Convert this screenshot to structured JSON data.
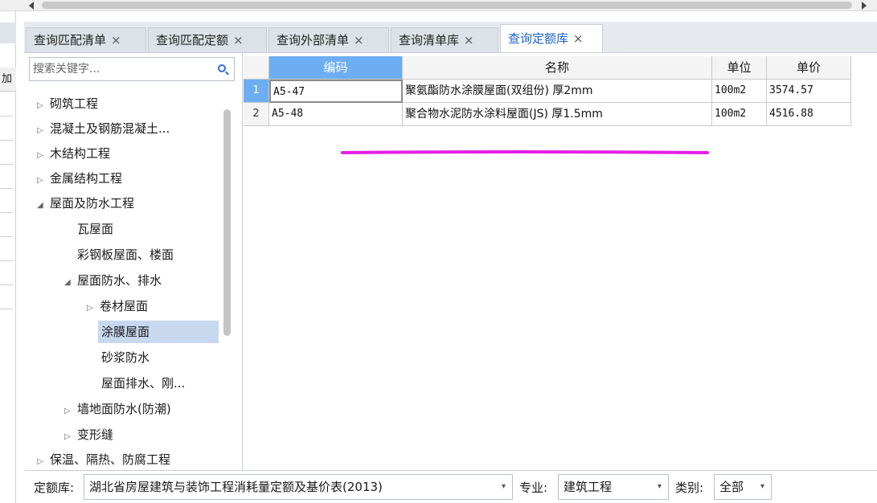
{
  "tabs": [
    {
      "label": "查询匹配清单",
      "active": false
    },
    {
      "label": "查询匹配定额",
      "active": false
    },
    {
      "label": "查询外部清单",
      "active": false
    },
    {
      "label": "查询清单库",
      "active": false
    },
    {
      "label": "查询定额库",
      "active": true
    }
  ],
  "tab_close_glyph": "×",
  "left_strip_header": "加",
  "search": {
    "placeholder": "搜索关键字..."
  },
  "tree": [
    {
      "label": "砌筑工程",
      "expanded": false,
      "level": 0
    },
    {
      "label": "混凝土及钢筋混凝土...",
      "expanded": false,
      "level": 0
    },
    {
      "label": "木结构工程",
      "expanded": false,
      "level": 0
    },
    {
      "label": "金属结构工程",
      "expanded": false,
      "level": 0
    },
    {
      "label": "屋面及防水工程",
      "expanded": true,
      "level": 0
    },
    {
      "label": "瓦屋面",
      "level": 1
    },
    {
      "label": "彩钢板屋面、楼面",
      "level": 1
    },
    {
      "label": "屋面防水、排水",
      "expanded": true,
      "level": 1
    },
    {
      "label": "卷材屋面",
      "expanded": false,
      "level": 2
    },
    {
      "label": "涂膜屋面",
      "level": 2,
      "selected": true
    },
    {
      "label": "砂浆防水",
      "level": 2
    },
    {
      "label": "屋面排水、刚...",
      "level": 2
    },
    {
      "label": "墙地面防水(防潮)",
      "expanded": false,
      "level": 1
    },
    {
      "label": "变形缝",
      "expanded": false,
      "level": 1
    },
    {
      "label": "保温、隔热、防腐工程",
      "expanded": false,
      "level": 0
    }
  ],
  "grid": {
    "columns": [
      "编码",
      "名称",
      "单位",
      "单价"
    ],
    "rows": [
      {
        "num": "1",
        "code": "A5-47",
        "name": "聚氨酯防水涂膜屋面(双组份) 厚2mm",
        "unit": "100m2",
        "price": "3574.57"
      },
      {
        "num": "2",
        "code": "A5-48",
        "name": "聚合物水泥防水涂料屋面(JS) 厚1.5mm",
        "unit": "100m2",
        "price": "4516.88"
      }
    ],
    "selected_row": 1
  },
  "annotation_color": "#e61ee6",
  "bottom": {
    "quota_label": "定额库:",
    "quota_value": "湖北省房屋建筑与装饰工程消耗量定额及基价表(2013)",
    "major_label": "专业:",
    "major_value": "建筑工程",
    "category_label": "类别:",
    "category_value": "全部"
  },
  "icons": {
    "search": "search-icon",
    "dropdown": "chevron-down-icon",
    "expand": "triangle-right-icon",
    "collapse": "triangle-down-icon"
  }
}
